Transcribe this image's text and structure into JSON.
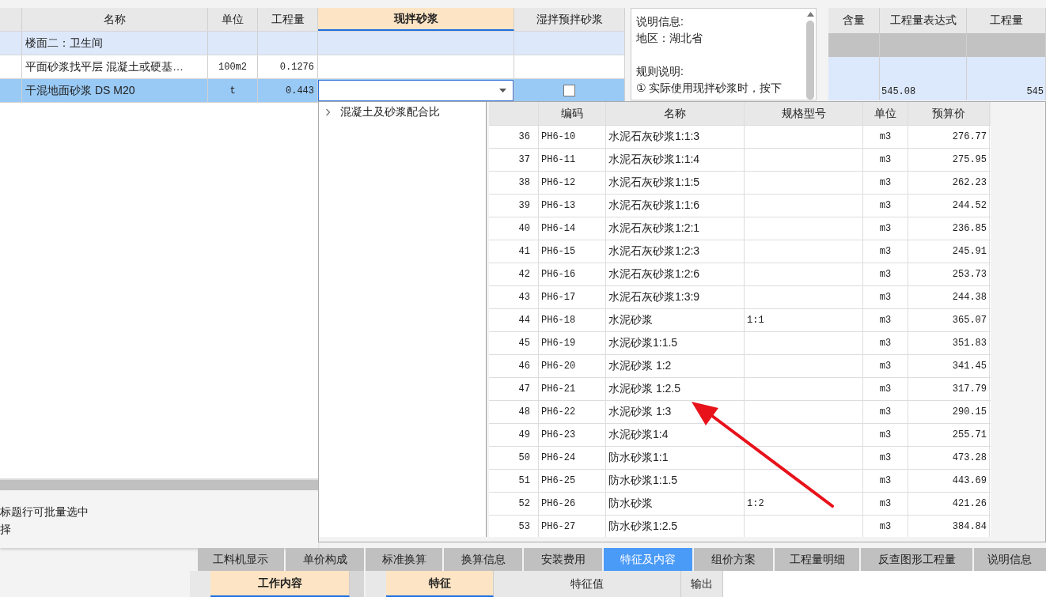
{
  "main_table": {
    "columns": [
      {
        "label": "名称",
        "selected": false
      },
      {
        "label": "单位",
        "selected": false
      },
      {
        "label": "工程量",
        "selected": false
      },
      {
        "label": "现拌砂浆",
        "selected": true
      },
      {
        "label": "湿拌预拌砂浆",
        "selected": false
      }
    ],
    "rows": [
      {
        "kind": "group",
        "name": "楼面二：卫生间",
        "unit": "",
        "quantity": "",
        "selected": false
      },
      {
        "kind": "item",
        "name": "平面砂浆找平层 混凝土或硬基…",
        "unit": "100m2",
        "quantity": "0.1276",
        "selected": false
      },
      {
        "kind": "editing",
        "name": "干混地面砂浆 DS M20",
        "unit": "t",
        "quantity": "0.443",
        "selected": true,
        "wet_mix_checked": false
      }
    ]
  },
  "info_panel": {
    "sections": [
      {
        "lines": [
          "说明信息:",
          "地区：湖北省"
        ]
      },
      {
        "lines": [
          "规则说明:",
          "① 实际使用现拌砂浆时，按下"
        ]
      }
    ]
  },
  "right_table": {
    "columns": [
      "含量",
      "工程量表达式",
      "工程量"
    ],
    "rows": [
      {
        "kind": "header",
        "cells": [
          "",
          "",
          ""
        ]
      },
      {
        "kind": "data",
        "cells": [
          "",
          "545.08",
          "545"
        ]
      }
    ]
  },
  "popup": {
    "tree": [
      {
        "label": "混凝土及砂浆配合比",
        "expanded": false
      }
    ],
    "columns": [
      "编码",
      "名称",
      "规格型号",
      "单位",
      "预算价"
    ],
    "rows": [
      {
        "index": "36",
        "code": "PH6-10",
        "name": "水泥石灰砂浆1:1:3",
        "spec": "",
        "unit": "m3",
        "price": "276.77"
      },
      {
        "index": "37",
        "code": "PH6-11",
        "name": "水泥石灰砂浆1:1:4",
        "spec": "",
        "unit": "m3",
        "price": "275.95"
      },
      {
        "index": "38",
        "code": "PH6-12",
        "name": "水泥石灰砂浆1:1:5",
        "spec": "",
        "unit": "m3",
        "price": "262.23"
      },
      {
        "index": "39",
        "code": "PH6-13",
        "name": "水泥石灰砂浆1:1:6",
        "spec": "",
        "unit": "m3",
        "price": "244.52"
      },
      {
        "index": "40",
        "code": "PH6-14",
        "name": "水泥石灰砂浆1:2:1",
        "spec": "",
        "unit": "m3",
        "price": "236.85"
      },
      {
        "index": "41",
        "code": "PH6-15",
        "name": "水泥石灰砂浆1:2:3",
        "spec": "",
        "unit": "m3",
        "price": "245.91"
      },
      {
        "index": "42",
        "code": "PH6-16",
        "name": "水泥石灰砂浆1:2:6",
        "spec": "",
        "unit": "m3",
        "price": "253.73"
      },
      {
        "index": "43",
        "code": "PH6-17",
        "name": "水泥石灰砂浆1:3:9",
        "spec": "",
        "unit": "m3",
        "price": "244.38"
      },
      {
        "index": "44",
        "code": "PH6-18",
        "name": "水泥砂浆",
        "spec": "1:1",
        "unit": "m3",
        "price": "365.07"
      },
      {
        "index": "45",
        "code": "PH6-19",
        "name": "水泥砂浆1:1.5",
        "spec": "",
        "unit": "m3",
        "price": "351.83"
      },
      {
        "index": "46",
        "code": "PH6-20",
        "name": "水泥砂浆 1:2",
        "spec": "",
        "unit": "m3",
        "price": "341.45"
      },
      {
        "index": "47",
        "code": "PH6-21",
        "name": "水泥砂浆 1:2.5",
        "spec": "",
        "unit": "m3",
        "price": "317.79"
      },
      {
        "index": "48",
        "code": "PH6-22",
        "name": "水泥砂浆 1:3",
        "spec": "",
        "unit": "m3",
        "price": "290.15"
      },
      {
        "index": "49",
        "code": "PH6-23",
        "name": "水泥砂浆1:4",
        "spec": "",
        "unit": "m3",
        "price": "255.71"
      },
      {
        "index": "50",
        "code": "PH6-24",
        "name": "防水砂浆1:1",
        "spec": "",
        "unit": "m3",
        "price": "473.28"
      },
      {
        "index": "51",
        "code": "PH6-25",
        "name": "防水砂浆1:1.5",
        "spec": "",
        "unit": "m3",
        "price": "443.69"
      },
      {
        "index": "52",
        "code": "PH6-26",
        "name": "防水砂浆",
        "spec": "1:2",
        "unit": "m3",
        "price": "421.26"
      },
      {
        "index": "53",
        "code": "PH6-27",
        "name": "防水砂浆1:2.5",
        "spec": "",
        "unit": "m3",
        "price": "384.84"
      }
    ]
  },
  "hint": {
    "lines": [
      "标题行可批量选中",
      "择"
    ]
  },
  "bottom_tabs": [
    {
      "label": "工料机显示",
      "selected": false
    },
    {
      "label": "单价构成",
      "selected": false
    },
    {
      "label": "标准换算",
      "selected": false
    },
    {
      "label": "换算信息",
      "selected": false
    },
    {
      "label": "安装费用",
      "selected": false
    },
    {
      "label": "特征及内容",
      "selected": true
    },
    {
      "label": "组价方案",
      "selected": false
    },
    {
      "label": "工程量明细",
      "selected": false
    },
    {
      "label": "反查图形工程量",
      "selected": false
    },
    {
      "label": "说明信息",
      "selected": false
    }
  ],
  "work_grid": {
    "columns": [
      "工作内容"
    ]
  },
  "feature_grid": {
    "columns": [
      "特征",
      "特征值",
      "输出"
    ]
  }
}
